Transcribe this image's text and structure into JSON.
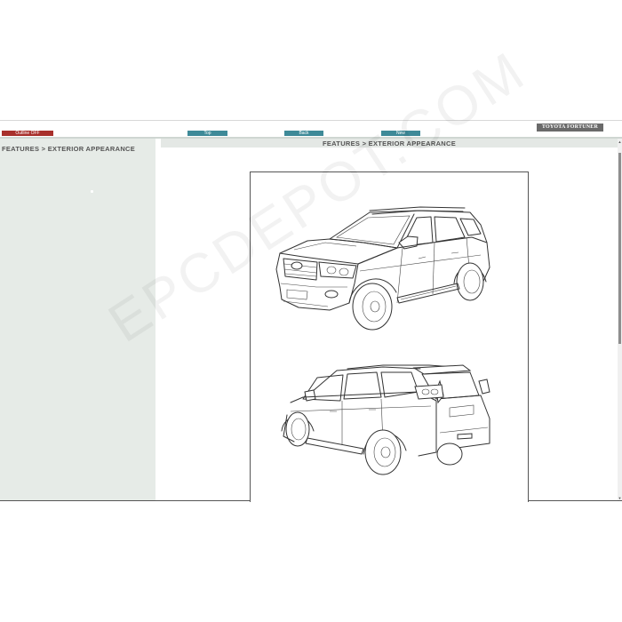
{
  "header": {
    "model": "TOYOTA FORTUNER"
  },
  "toolbar": {
    "outline_label": "Outline OFF",
    "top_label": "Top",
    "back_label": "Back",
    "new_label": "New"
  },
  "sidebar": {
    "title": "FEATURES > EXTERIOR APPEARANCE"
  },
  "content": {
    "title": "FEATURES > EXTERIOR APPEARANCE"
  },
  "watermark": "EPCDEPOT.COM"
}
